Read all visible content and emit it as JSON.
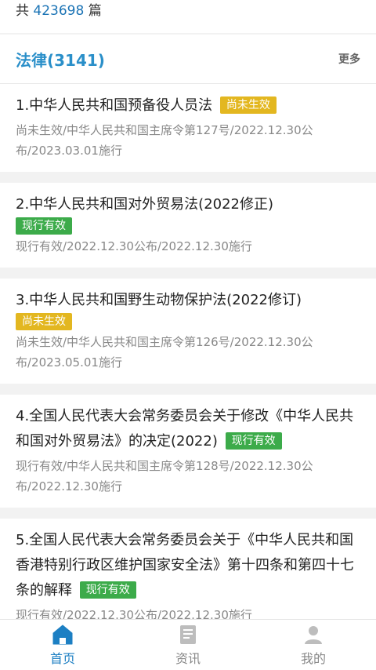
{
  "header": {
    "total_prefix": "共",
    "total_count": "423698",
    "total_suffix": "篇"
  },
  "section": {
    "title": "法律(3141)",
    "more": "更多"
  },
  "items": [
    {
      "title": "1.中华人民共和国预备役人员法",
      "status": "尚未生效",
      "status_type": "pending",
      "meta": "尚未生效/中华人民共和国主席令第127号/2022.12.30公布/2023.03.01施行"
    },
    {
      "title": "2.中华人民共和国对外贸易法(2022修正)",
      "status": "现行有效",
      "status_type": "valid",
      "meta": "现行有效/2022.12.30公布/2022.12.30施行"
    },
    {
      "title": "3.中华人民共和国野生动物保护法(2022修订)",
      "status": "尚未生效",
      "status_type": "pending",
      "meta": "尚未生效/中华人民共和国主席令第126号/2022.12.30公布/2023.05.01施行"
    },
    {
      "title": "4.全国人民代表大会常务委员会关于修改《中华人民共和国对外贸易法》的决定(2022)",
      "status": "现行有效",
      "status_type": "valid",
      "meta": "现行有效/中华人民共和国主席令第128号/2022.12.30公布/2022.12.30施行"
    },
    {
      "title": "5.全国人民代表大会常务委员会关于《中华人民共和国香港特别行政区维护国家安全法》第十四条和第四十七条的解释",
      "status": "现行有效",
      "status_type": "valid",
      "meta": "现行有效/2022.12.30公布/2022.12.30施行"
    }
  ],
  "nav": [
    {
      "label": "首页",
      "icon": "home-icon",
      "active": true
    },
    {
      "label": "资讯",
      "icon": "news-icon",
      "active": false
    },
    {
      "label": "我的",
      "icon": "user-icon",
      "active": false
    }
  ],
  "colors": {
    "accent": "#2a8fc9",
    "pending": "#e3b720",
    "valid": "#3cab4a",
    "nav_active": "#1c7fc3",
    "nav_inactive": "#bdbdbd"
  }
}
